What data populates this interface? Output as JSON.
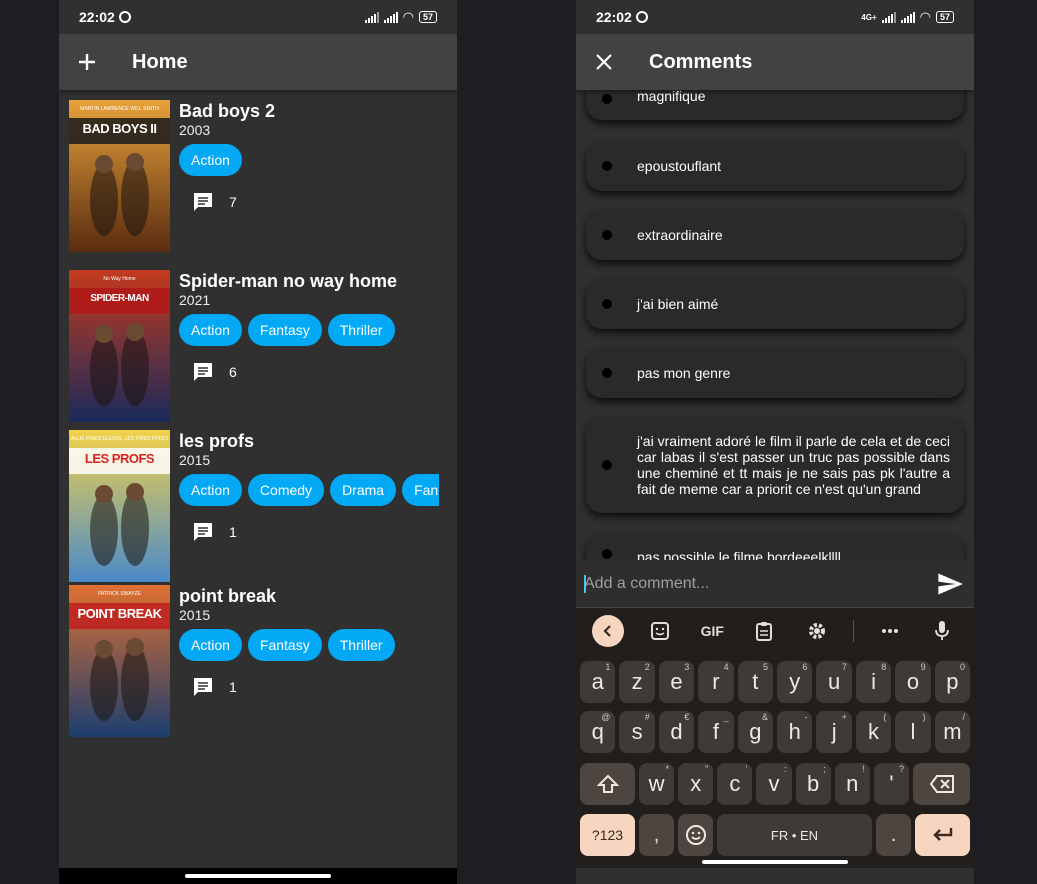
{
  "left": {
    "status": {
      "time": "22:02",
      "battery": "57"
    },
    "appbar": {
      "title": "Home",
      "add_icon": "plus-icon"
    },
    "movies": [
      {
        "title": "Bad boys 2",
        "year": "2003",
        "genres": [
          "Action"
        ],
        "comments": "7",
        "poster_text": "BAD BOYS II",
        "poster_sub": "MARTIN LAWRENCE   WILL SMITH"
      },
      {
        "title": "Spider-man no way home",
        "year": "2021",
        "genres": [
          "Action",
          "Fantasy",
          "Thriller"
        ],
        "comments": "6",
        "poster_text": "SPIDER-MAN",
        "poster_sub": "No Way Home"
      },
      {
        "title": "les profs",
        "year": "2015",
        "genres": [
          "Action",
          "Comedy",
          "Drama",
          "Fantasy"
        ],
        "comments": "1",
        "poster_text": "LES PROFS",
        "poster_sub": "ALLIE PIRES ÉLÈVES, LES PIRES PROFS"
      },
      {
        "title": "point break",
        "year": "2015",
        "genres": [
          "Action",
          "Fantasy",
          "Thriller"
        ],
        "comments": "1",
        "poster_text": "POINT BREAK",
        "poster_sub": "PATRICK SWAYZE"
      }
    ]
  },
  "right": {
    "status": {
      "time": "22:02",
      "network": "4G+",
      "battery": "57"
    },
    "appbar": {
      "title": "Comments",
      "close_icon": "close-icon"
    },
    "comments": [
      "magnifique",
      "epoustouflant",
      "extraordinaire",
      "j'ai bien aimé",
      "pas mon genre",
      "j'ai vraiment adoré le film il parle de cela et de ceci car labas il s'est  passer un truc pas possible dans une cheminé et tt mais je ne sais pas pk l'autre a fait de meme car a priorit ce n'est qu'un grand",
      "pas possible le filme bordeeelkllll"
    ],
    "input": {
      "placeholder": "Add a comment..."
    },
    "keyboard": {
      "toolbar": {
        "gif": "GIF"
      },
      "row1": [
        [
          "a",
          "1"
        ],
        [
          "z",
          "2"
        ],
        [
          "e",
          "3"
        ],
        [
          "r",
          "4"
        ],
        [
          "t",
          "5"
        ],
        [
          "y",
          "6"
        ],
        [
          "u",
          "7"
        ],
        [
          "i",
          "8"
        ],
        [
          "o",
          "9"
        ],
        [
          "p",
          "0"
        ]
      ],
      "row2": [
        [
          "q",
          "@"
        ],
        [
          "s",
          "#"
        ],
        [
          "d",
          "€"
        ],
        [
          "f",
          "_"
        ],
        [
          "g",
          "&"
        ],
        [
          "h",
          "-"
        ],
        [
          "j",
          "+"
        ],
        [
          "k",
          "("
        ],
        [
          "l",
          ")"
        ],
        [
          "m",
          "/"
        ]
      ],
      "row3": [
        [
          "w",
          "*"
        ],
        [
          "x",
          "\""
        ],
        [
          "c",
          "'"
        ],
        [
          "v",
          ":"
        ],
        [
          "b",
          ";"
        ],
        [
          "n",
          "!"
        ],
        [
          "'",
          "?"
        ]
      ],
      "symbols_label": "?123",
      "comma": ",",
      "space_label": "FR • EN",
      "period": "."
    }
  },
  "colors": {
    "chip": "#03a9f4",
    "appbar": "#424242",
    "background": "#303030",
    "card": "#2a2a2a",
    "keyboard_accent": "#f6d6c1"
  }
}
